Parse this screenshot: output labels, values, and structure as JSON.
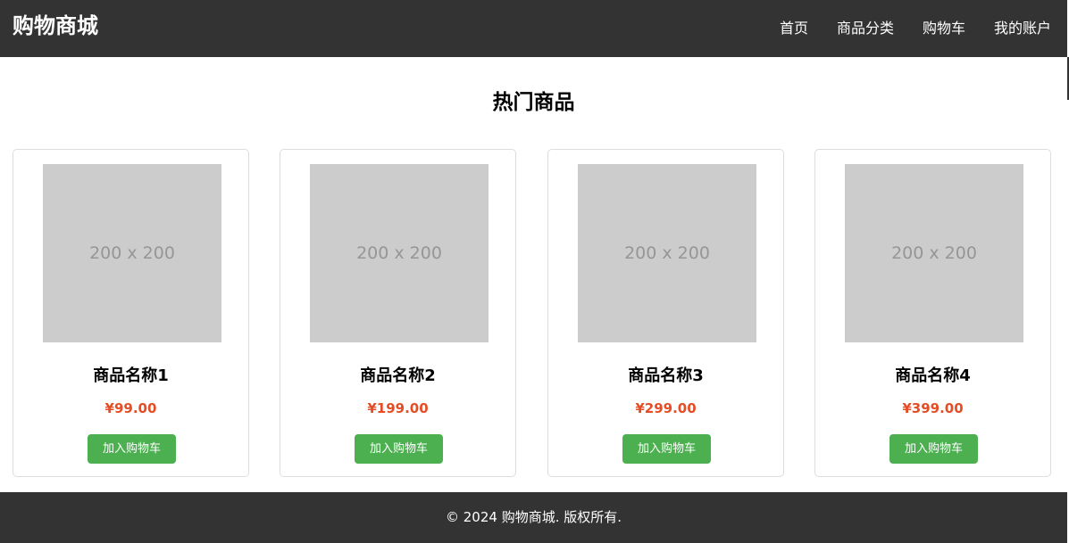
{
  "header": {
    "logo": "购物商城",
    "nav": [
      {
        "label": "首页"
      },
      {
        "label": "商品分类"
      },
      {
        "label": "购物车"
      },
      {
        "label": "我的账户"
      }
    ]
  },
  "main": {
    "title": "热门商品",
    "products": [
      {
        "image_text": "200 x 200",
        "name": "商品名称1",
        "price": "¥99.00",
        "button": "加入购物车"
      },
      {
        "image_text": "200 x 200",
        "name": "商品名称2",
        "price": "¥199.00",
        "button": "加入购物车"
      },
      {
        "image_text": "200 x 200",
        "name": "商品名称3",
        "price": "¥299.00",
        "button": "加入购物车"
      },
      {
        "image_text": "200 x 200",
        "name": "商品名称4",
        "price": "¥399.00",
        "button": "加入购物车"
      }
    ]
  },
  "footer": {
    "text": "© 2024 购物商城. 版权所有."
  },
  "colors": {
    "header_bg": "#333333",
    "price": "#e44d26",
    "button": "#4caf50",
    "placeholder_bg": "#cccccc",
    "card_border": "#dddddd"
  }
}
